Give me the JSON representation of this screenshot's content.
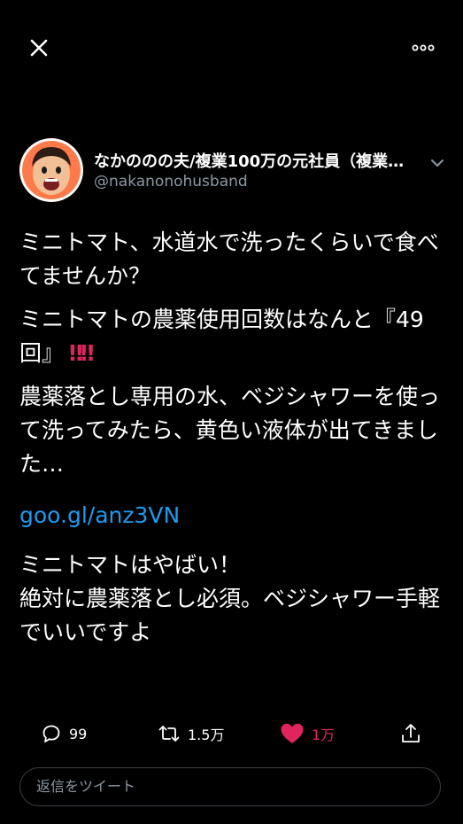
{
  "tweet": {
    "author_name": "なかののの夫/複業100万の元社員（複業…",
    "author_handle": "@nakanonohusband",
    "paragraphs": [
      "ミニトマト、水道水で洗ったくらいで食べてませんか？",
      "ミニトマトの農薬使用回数はなんと『49回』",
      "農薬落とし専用の水、ベジシャワーを使って洗ってみたら、黄色い液体が出てきました…"
    ],
    "bangs": "‼‼",
    "link": "goo.gl/anz3VN",
    "closing": "ミニトマトはやばい！\n絶対に農薬落とし必須。ベジシャワー手軽でいいですよ"
  },
  "actions": {
    "reply_count": "99",
    "retweet_count": "1.5万",
    "like_count": "1万",
    "liked": true
  },
  "reply_box": {
    "placeholder": "返信をツイート"
  },
  "colors": {
    "background": "#000000",
    "link": "#1d9bf0",
    "like": "#e0245e",
    "muted": "#8b98a5"
  },
  "icons": {
    "close": "close-icon",
    "more": "more-icon",
    "caret": "chevron-down-icon",
    "reply": "reply-icon",
    "retweet": "retweet-icon",
    "like": "heart-icon",
    "share": "share-icon"
  }
}
